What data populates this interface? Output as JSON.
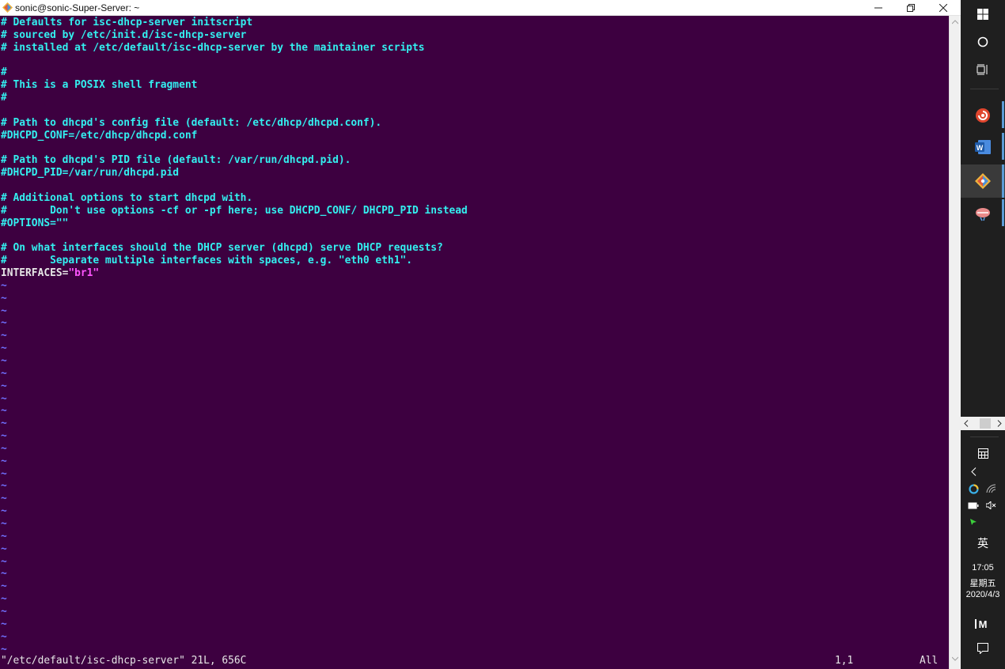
{
  "window": {
    "title": "sonic@sonic-Super-Server: ~"
  },
  "editor": {
    "lines": [
      {
        "segments": [
          {
            "text": "# Defaults for isc-dhcp-server initscript",
            "style": "comment"
          }
        ]
      },
      {
        "segments": [
          {
            "text": "# sourced by /etc/init.d/isc-dhcp-server",
            "style": "comment"
          }
        ]
      },
      {
        "segments": [
          {
            "text": "# installed at /etc/default/isc-dhcp-server by the maintainer scripts",
            "style": "comment"
          }
        ]
      },
      {
        "segments": [
          {
            "text": "",
            "style": "plain"
          }
        ]
      },
      {
        "segments": [
          {
            "text": "#",
            "style": "comment"
          }
        ]
      },
      {
        "segments": [
          {
            "text": "# This is a POSIX shell fragment",
            "style": "comment"
          }
        ]
      },
      {
        "segments": [
          {
            "text": "#",
            "style": "comment"
          }
        ]
      },
      {
        "segments": [
          {
            "text": "",
            "style": "plain"
          }
        ]
      },
      {
        "segments": [
          {
            "text": "# Path to dhcpd's config file (default: /etc/dhcp/dhcpd.conf).",
            "style": "comment"
          }
        ]
      },
      {
        "segments": [
          {
            "text": "#DHCPD_CONF=/etc/dhcp/dhcpd.conf",
            "style": "comment"
          }
        ]
      },
      {
        "segments": [
          {
            "text": "",
            "style": "plain"
          }
        ]
      },
      {
        "segments": [
          {
            "text": "# Path to dhcpd's PID file (default: /var/run/dhcpd.pid).",
            "style": "comment"
          }
        ]
      },
      {
        "segments": [
          {
            "text": "#DHCPD_PID=/var/run/dhcpd.pid",
            "style": "comment"
          }
        ]
      },
      {
        "segments": [
          {
            "text": "",
            "style": "plain"
          }
        ]
      },
      {
        "segments": [
          {
            "text": "# Additional options to start dhcpd with.",
            "style": "comment"
          }
        ]
      },
      {
        "segments": [
          {
            "text": "#       Don't use options -cf or -pf here; use DHCPD_CONF/ DHCPD_PID instead",
            "style": "comment"
          }
        ]
      },
      {
        "segments": [
          {
            "text": "#OPTIONS=\"\"",
            "style": "comment"
          }
        ]
      },
      {
        "segments": [
          {
            "text": "",
            "style": "plain"
          }
        ]
      },
      {
        "segments": [
          {
            "text": "# On what interfaces should the DHCP server (dhcpd) serve DHCP requests?",
            "style": "comment"
          }
        ]
      },
      {
        "segments": [
          {
            "text": "#       Separate multiple interfaces with spaces, e.g. \"eth0 eth1\".",
            "style": "comment"
          }
        ]
      },
      {
        "segments": [
          {
            "text": "INTERFACES=",
            "style": "plain"
          },
          {
            "text": "\"br1\"",
            "style": "string"
          }
        ]
      }
    ],
    "tilde": "~",
    "tilde_count": 30,
    "status_file": "\"/etc/default/isc-dhcp-server\" 21L, 656C",
    "cursor_pos": "1,1",
    "scroll_pos": "All",
    "colors": {
      "background": "#3d0040",
      "comment": "#33f0f0",
      "string": "#ff55ff",
      "tilde": "#7070ff",
      "plain": "#e6e6e6"
    }
  },
  "taskbar": {
    "icons": [
      "windows-start-icon",
      "cortana-search-icon",
      "task-view-icon",
      "app-swirl-icon",
      "word-icon",
      "git-icon",
      "app-bird-icon"
    ],
    "tray": {
      "ime": "英",
      "time": "17:05",
      "weekday": "星期五",
      "date": "2020/4/3"
    }
  }
}
